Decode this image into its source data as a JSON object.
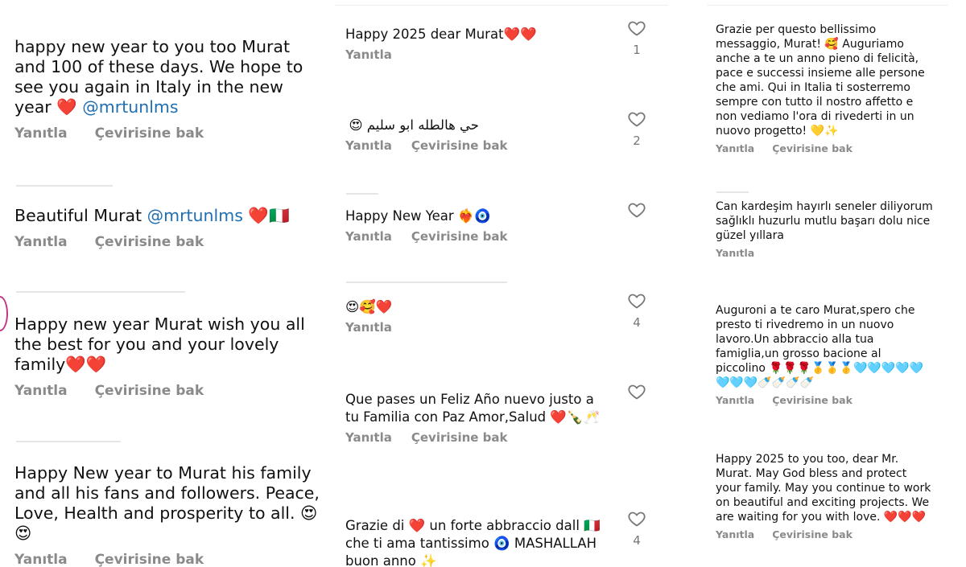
{
  "action_labels": {
    "reply": "Yanıtla",
    "translate": "Çevirisine bak"
  },
  "col1": [
    {
      "text": "happy new year to you too Murat and 100 of these days. We hope to see you again in Italy in the new year ❤️ ",
      "mention": "@mrtunlms"
    },
    {
      "text": "Beautiful Murat ",
      "mention": "@mrtunlms",
      "suffix": " ❤️🇮🇹"
    },
    {
      "text": "Happy new year Murat wish you all the best for you and your lovely family❤️❤️"
    },
    {
      "text": "Happy New year to Murat his family and all his fans and followers. Peace, Love, Health and prosperity to all. 😍😍"
    }
  ],
  "col2": [
    {
      "text": "Happy 2025 dear Murat❤️❤️",
      "likes": "1"
    },
    {
      "text": "حي هالطله ابو سليم 😍",
      "likes": "2"
    },
    {
      "text": "Happy New Year ❤️‍🔥🧿",
      "likes": ""
    },
    {
      "text": "😍🥰❤️",
      "likes": "4"
    },
    {
      "text": "Que pases un Feliz Año nuevo justo a tu Familia con Paz Amor,Salud ❤️🍾🥂",
      "likes": ""
    },
    {
      "text": "Grazie di ❤️ un forte abbraccio dall 🇮🇹 che ti ama tantissimo 🧿 MASHALLAH buon anno ✨",
      "likes": "4"
    }
  ],
  "col3": [
    {
      "text": "Grazie per questo bellissimo messaggio, Murat! 🥰 Auguriamo anche a te un anno pieno di felicità, pace e successi insieme alle persone che ami. Qui in Italia ti sosterremo sempre con tutto il nostro affetto e non vediamo l'ora di rivederti in un nuovo progetto! 💛✨"
    },
    {
      "text": "Can kardeşim hayırlı seneler diliyorum sağlıklı huzurlu mutlu başarı dolu nice güzel yıllara"
    },
    {
      "text": "Auguroni a te caro Murat,spero che presto ti rivedremo in un nuovo lavoro.Un abbraccio alla tua famiglia,un grosso bacione al piccolino 🌹🌹🌹🥇🥇🥇🩵🩵🩵🩵🩵🩵🩵🩵🍼🍼🍼🍼"
    },
    {
      "text": "Happy 2025 to you too, dear Mr. Murat. May God bless and protect your family. May you continue to work on beautiful and exciting projects. We are waiting for you with love. ❤️❤️❤️"
    }
  ]
}
